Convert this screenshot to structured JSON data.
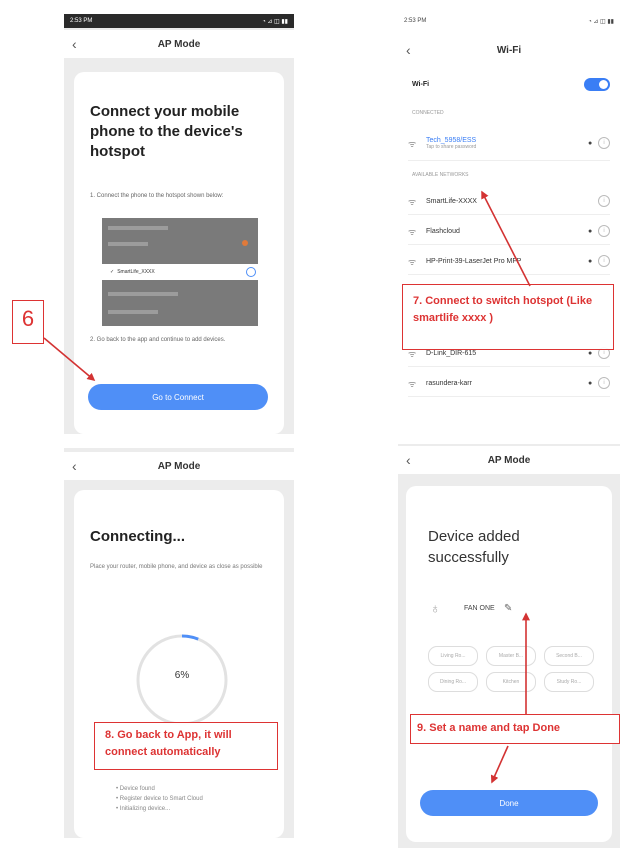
{
  "panel1": {
    "status_time": "2:53 PM",
    "status_icons": "◔ ⊿ ◫ ▮▮",
    "nav_title": "AP Mode",
    "heading": "Connect your mobile phone to the device's hotspot",
    "step1": "1. Connect the phone to the hotspot shown below:",
    "mini_network": "SmartLife_XXXX",
    "step2": "2. Go back to the app and continue to add devices.",
    "button": "Go to Connect"
  },
  "panel2": {
    "status_time": "2:53 PM",
    "nav_title": "Wi-Fi",
    "wifi_label": "Wi-Fi",
    "connected_header": "CONNECTED",
    "connected_network": "Tech_5958/ESS",
    "connected_sub": "Tap to share password",
    "available_header": "AVAILABLE NETWORKS",
    "networks": [
      {
        "name": "SmartLife-XXXX"
      },
      {
        "name": "Flashcloud"
      },
      {
        "name": "HP-Print-39-LaserJet Pro MFP"
      },
      {
        "name": "D-Link_DIR-615"
      },
      {
        "name": "rasundera-karr"
      }
    ]
  },
  "panel3": {
    "nav_title": "AP Mode",
    "heading": "Connecting...",
    "desc": "Place your router, mobile phone, and device as close as possible",
    "progress_percent": 6,
    "progress_label": "6%",
    "steps": [
      "Device found",
      "Register device to Smart Cloud",
      "Initializing device..."
    ]
  },
  "panel4": {
    "nav_title": "AP Mode",
    "heading": "Device added successfully",
    "device_name": "FAN ONE",
    "chips": [
      "Living Ro...",
      "Master B...",
      "Second B...",
      "Dining Ro...",
      "Kitchen",
      "Study Ro..."
    ],
    "button": "Done"
  },
  "annotations": {
    "a6": "6",
    "a7": "7. Connect to switch hotspot (Like smartlife xxxx )",
    "a8": "8. Go back to App, it will connect automatically",
    "a9": "9. Set a name and tap Done"
  },
  "colors": {
    "accent": "#4f8ff7",
    "annotation": "#d33333",
    "panel_bg": "#ececec"
  }
}
